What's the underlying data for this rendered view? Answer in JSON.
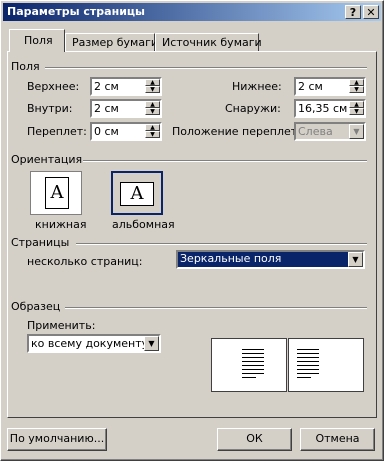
{
  "window": {
    "title": "Параметры страницы",
    "help_btn": "?",
    "close_btn": "✕"
  },
  "tabs": [
    {
      "label": "Поля",
      "active": true
    },
    {
      "label": "Размер бумаги",
      "active": false
    },
    {
      "label": "Источник бумаги",
      "active": false
    }
  ],
  "margins": {
    "group_label": "Поля",
    "top_label": "Верхнее:",
    "top_value": "2 см",
    "inside_label": "Внутри:",
    "inside_value": "2 см",
    "gutter_label": "Переплет:",
    "gutter_value": "0 см",
    "bottom_label": "Нижнее:",
    "bottom_value": "2 см",
    "outside_label": "Снаружи:",
    "outside_value": "16,35 см",
    "gutter_pos_label": "Положение переплета:",
    "gutter_pos_value": "Слева"
  },
  "orientation": {
    "group_label": "Ориентация",
    "portrait_label": "книжная",
    "landscape_label": "альбомная",
    "icon_letter": "A",
    "selected": "landscape"
  },
  "pages": {
    "group_label": "Страницы",
    "multiple_label": "несколько страниц:",
    "multiple_value": "Зеркальные поля"
  },
  "preview": {
    "group_label": "Образец",
    "apply_label": "Применить:",
    "apply_value": "ко всему документу"
  },
  "buttons": {
    "default": "По умолчанию...",
    "ok": "ОК",
    "cancel": "Отмена"
  },
  "colors": {
    "titlebar_start": "#0a246a",
    "titlebar_end": "#a6caf0",
    "face": "#d4d0c8",
    "selection": "#0a246a"
  }
}
